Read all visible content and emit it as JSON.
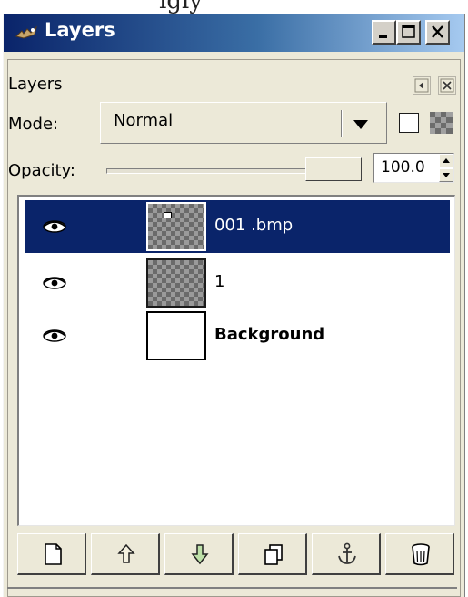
{
  "caption_strip_text": "igly",
  "window": {
    "title": "Layers",
    "controls": {
      "minimize_icon": "minimize-icon",
      "maximize_icon": "maximize-icon",
      "close_icon": "close-icon"
    }
  },
  "dock": {
    "title": "Layers",
    "menu_icon": "dock-menu-arrow-icon",
    "close_icon": "dock-close-icon"
  },
  "mode": {
    "label": "Mode:",
    "value": "Normal"
  },
  "opacity": {
    "label": "Opacity:",
    "value": "100.0",
    "level": 1.0
  },
  "layers": [
    {
      "name": "001 .bmp",
      "visible": true,
      "selected": true,
      "thumbnail": "checker",
      "bold": false
    },
    {
      "name": "1",
      "visible": true,
      "selected": false,
      "thumbnail": "checker",
      "bold": false
    },
    {
      "name": "Background",
      "visible": true,
      "selected": false,
      "thumbnail": "white",
      "bold": true
    }
  ],
  "toolbar": [
    {
      "name": "new-layer-button",
      "icon": "new-document-icon"
    },
    {
      "name": "raise-layer-button",
      "icon": "arrow-up-icon"
    },
    {
      "name": "lower-layer-button",
      "icon": "arrow-down-icon"
    },
    {
      "name": "duplicate-layer-button",
      "icon": "duplicate-icon"
    },
    {
      "name": "anchor-layer-button",
      "icon": "anchor-icon"
    },
    {
      "name": "delete-layer-button",
      "icon": "trash-icon"
    }
  ],
  "colors": {
    "selection": "#0a246a",
    "window_bg": "#ece9d8",
    "titlebar_start": "#0a246a",
    "titlebar_end": "#a6caf0"
  }
}
